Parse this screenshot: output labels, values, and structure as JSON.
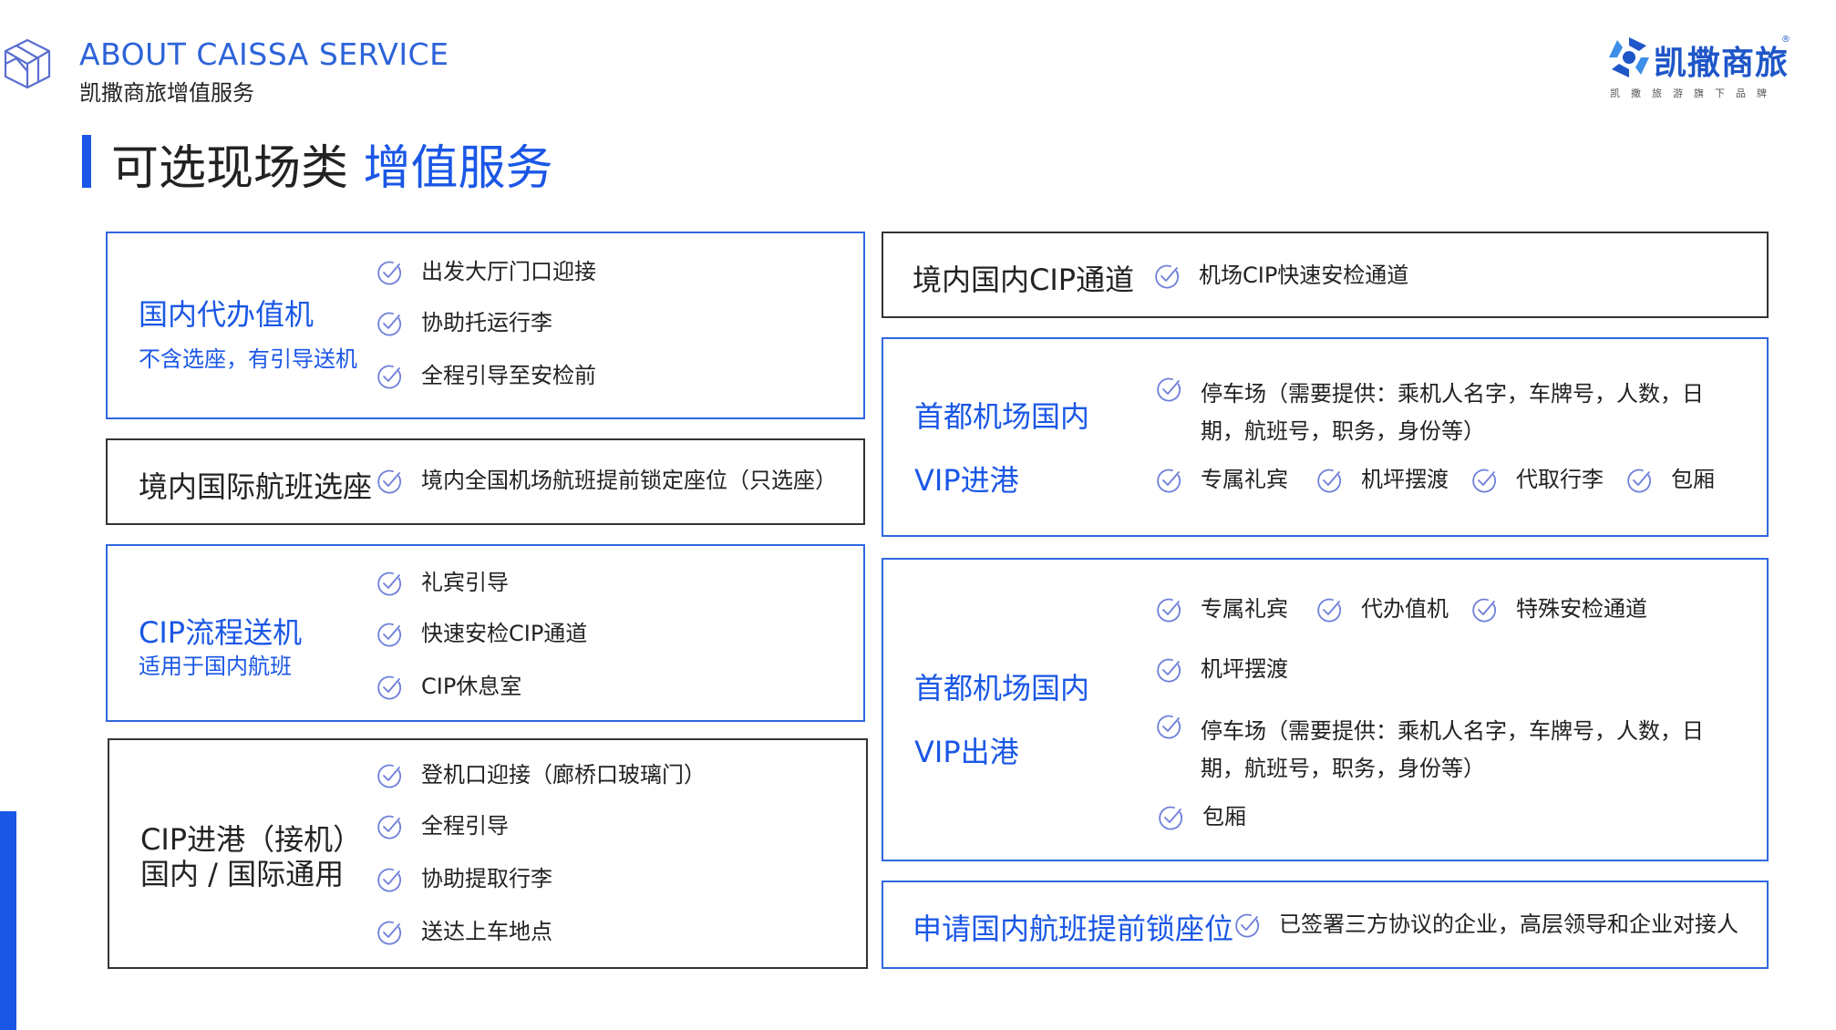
{
  "header": {
    "en_title": "ABOUT  CAISSA SERVICE",
    "cn_subtitle": "凯撒商旅增值服务",
    "brand_name": "凯撒商旅",
    "brand_reg": "®",
    "brand_tagline": "凯撒旅游旗下品牌"
  },
  "page_title": {
    "normal": "可选现场类 ",
    "highlight": "增值服务"
  },
  "colors": {
    "accent": "#1a57e6",
    "border_blue": "#2f67e0",
    "border_dark": "#333333",
    "check": "#6f7fd9"
  },
  "left": {
    "box1": {
      "heading": "国内代办值机",
      "subhead": "不含选座，有引导送机",
      "items": [
        "出发大厅门口迎接",
        "协助托运行李",
        "全程引导至安检前"
      ]
    },
    "box2": {
      "heading": "境内国际航班选座",
      "items": [
        "境内全国机场航班提前锁定座位（只选座）"
      ]
    },
    "box3": {
      "heading": "CIP流程送机",
      "subhead": "适用于国内航班",
      "items": [
        "礼宾引导",
        "快速安检CIP通道",
        "CIP休息室"
      ]
    },
    "box4": {
      "heading_line1": "CIP进港（接机）",
      "heading_line2": "国内 / 国际通用",
      "items": [
        "登机口迎接（廊桥口玻璃门）",
        "全程引导",
        "协助提取行李",
        "送达上车地点"
      ]
    }
  },
  "right": {
    "box1": {
      "heading": "境内国内CIP通道",
      "items": [
        "机场CIP快速安检通道"
      ]
    },
    "box2": {
      "heading_line1": "首都机场国内",
      "heading_line2": "VIP进港",
      "parking": "停车场（需要提供：乘机人名字，车牌号，人数，日期，航班号，职务，身份等）",
      "items": [
        "专属礼宾",
        "机坪摆渡",
        "代取行李",
        "包厢"
      ]
    },
    "box3": {
      "heading_line1": "首都机场国内",
      "heading_line2": "VIP出港",
      "row1": [
        "专属礼宾",
        "代办值机",
        "特殊安检通道"
      ],
      "shuttle": "机坪摆渡",
      "parking": "停车场（需要提供：乘机人名字，车牌号，人数，日期，航班号，职务，身份等）",
      "room": "包厢"
    },
    "box4": {
      "heading": "申请国内航班提前锁座位",
      "items": [
        "已签署三方协议的企业，高层领导和企业对接人"
      ]
    }
  }
}
